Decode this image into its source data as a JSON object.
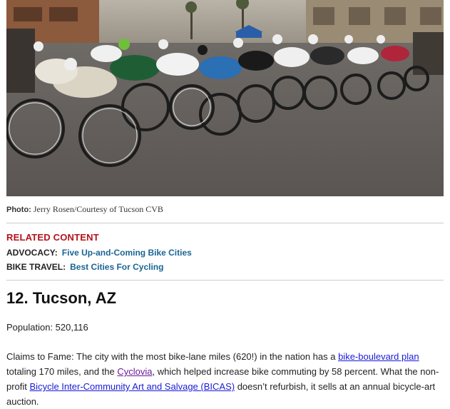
{
  "photo": {
    "alt": "Bike race peloton on a city street",
    "caption_label": "Photo:",
    "caption_text": "Jerry Rosen/Courtesy of Tucson CVB"
  },
  "related": {
    "heading": "RELATED CONTENT",
    "items": [
      {
        "category": "ADVOCACY:",
        "link": "Five Up-and-Coming Bike Cities"
      },
      {
        "category": "BIKE TRAVEL:",
        "link": "Best Cities For Cycling"
      }
    ]
  },
  "article": {
    "title": "12. Tucson, AZ",
    "population": "Population: 520,116",
    "claims": {
      "t1": "Claims to Fame: The city with the most bike-lane miles (620!) in the nation has a ",
      "link1": "bike-boulevard plan",
      "t2": " totaling 170 miles, and the ",
      "link2": "Cyclovia",
      "t3": ", which helped increase bike commuting by 58 percent. What the non-profit ",
      "link3": "Bicycle Inter-Community Art and Salvage (BICAS)",
      "t4": " doesn’t refurbish, it sells at an annual bicycle-art auction."
    }
  },
  "colors": {
    "related_heading": "#b3121b",
    "related_link": "#1a6496",
    "body_link": "#1a1ad6",
    "visited_link": "#6a1b9a"
  }
}
